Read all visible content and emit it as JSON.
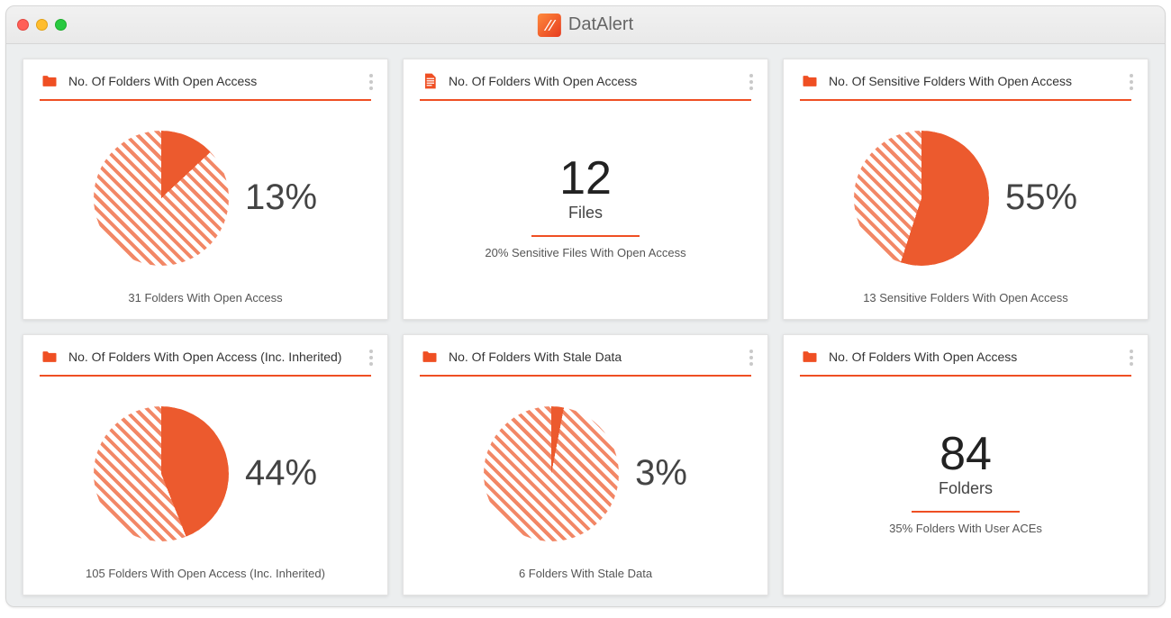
{
  "app": {
    "title": "DatAlert"
  },
  "colors": {
    "accent": "#ef4f23",
    "slice": "#ec5a2e"
  },
  "cards": [
    {
      "icon": "folder",
      "title": "No. Of Folders With Open Access",
      "type": "pie",
      "percent": 13,
      "percent_label": "13%",
      "footer": "31 Folders With Open Access"
    },
    {
      "icon": "file",
      "title": "No. Of Folders With Open Access",
      "type": "number",
      "value": "12",
      "unit": "Files",
      "subtext": "20% Sensitive Files With Open Access"
    },
    {
      "icon": "folder",
      "title": "No. Of Sensitive Folders With Open Access",
      "type": "pie",
      "percent": 55,
      "percent_label": "55%",
      "footer": "13 Sensitive Folders With Open Access"
    },
    {
      "icon": "folder",
      "title": "No. Of Folders With Open Access (Inc. Inherited)",
      "type": "pie",
      "percent": 44,
      "percent_label": "44%",
      "footer": "105 Folders With Open Access (Inc. Inherited)"
    },
    {
      "icon": "folder",
      "title": "No. Of Folders With Stale Data",
      "type": "pie",
      "percent": 3,
      "percent_label": "3%",
      "footer": "6 Folders With Stale Data"
    },
    {
      "icon": "folder",
      "title": "No. Of Folders With Open Access",
      "type": "number",
      "value": "84",
      "unit": "Folders",
      "subtext": "35% Folders With User ACEs"
    }
  ],
  "chart_data": [
    {
      "type": "pie",
      "title": "No. Of Folders With Open Access",
      "series": [
        {
          "name": "highlighted",
          "value": 13
        },
        {
          "name": "rest",
          "value": 87
        }
      ],
      "label": "13%",
      "annotation": "31 Folders With Open Access"
    },
    {
      "type": "table",
      "title": "No. Of Folders With Open Access",
      "value": 12,
      "unit": "Files",
      "annotation": "20% Sensitive Files With Open Access"
    },
    {
      "type": "pie",
      "title": "No. Of Sensitive Folders With Open Access",
      "series": [
        {
          "name": "highlighted",
          "value": 55
        },
        {
          "name": "rest",
          "value": 45
        }
      ],
      "label": "55%",
      "annotation": "13 Sensitive Folders With Open Access"
    },
    {
      "type": "pie",
      "title": "No. Of Folders With Open Access (Inc. Inherited)",
      "series": [
        {
          "name": "highlighted",
          "value": 44
        },
        {
          "name": "rest",
          "value": 56
        }
      ],
      "label": "44%",
      "annotation": "105 Folders With Open Access (Inc. Inherited)"
    },
    {
      "type": "pie",
      "title": "No. Of Folders With Stale Data",
      "series": [
        {
          "name": "highlighted",
          "value": 3
        },
        {
          "name": "rest",
          "value": 97
        }
      ],
      "label": "3%",
      "annotation": "6 Folders With Stale Data"
    },
    {
      "type": "table",
      "title": "No. Of Folders With Open Access",
      "value": 84,
      "unit": "Folders",
      "annotation": "35% Folders With User ACEs"
    }
  ]
}
